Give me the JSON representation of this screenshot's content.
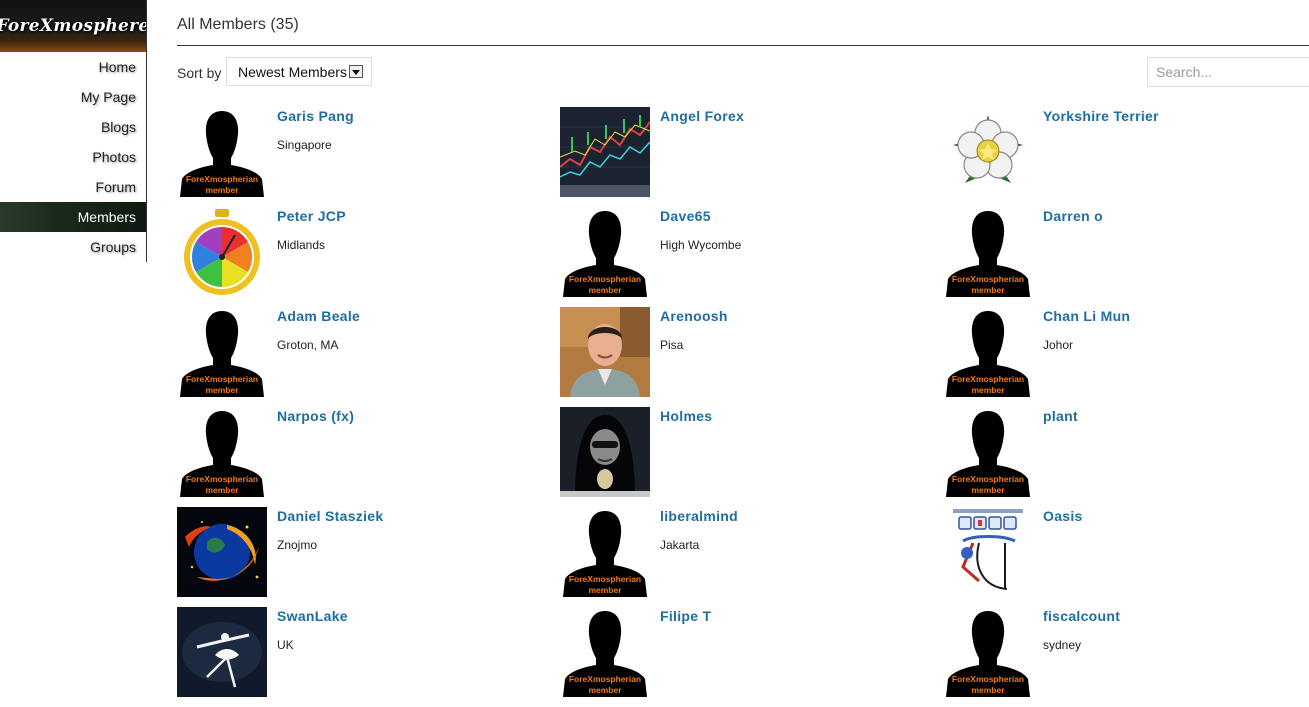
{
  "site": {
    "logo_text": "ForeXmosphere"
  },
  "nav": [
    {
      "label": "Home",
      "active": false
    },
    {
      "label": "My Page",
      "active": false
    },
    {
      "label": "Blogs",
      "active": false
    },
    {
      "label": "Photos",
      "active": false
    },
    {
      "label": "Forum",
      "active": false
    },
    {
      "label": "Members",
      "active": true
    },
    {
      "label": "Groups",
      "active": false
    }
  ],
  "page": {
    "title": "All Members (35)"
  },
  "sort": {
    "label": "Sort by",
    "selected": "Newest Members"
  },
  "search": {
    "placeholder": "Search..."
  },
  "silhouette_text": [
    "ForeXmospherian",
    "member"
  ],
  "members": [
    {
      "name": "Garis Pang",
      "location": "Singapore",
      "avatar": "silhouette"
    },
    {
      "name": "Angel Forex",
      "location": "",
      "avatar": "forex-chart"
    },
    {
      "name": "Yorkshire Terrier",
      "location": "",
      "avatar": "white-rose"
    },
    {
      "name": "Peter JCP",
      "location": "Midlands",
      "avatar": "stopwatch"
    },
    {
      "name": "Dave65",
      "location": "High Wycombe",
      "avatar": "silhouette"
    },
    {
      "name": "Darren o",
      "location": "",
      "avatar": "silhouette"
    },
    {
      "name": "Adam Beale",
      "location": "Groton, MA",
      "avatar": "silhouette"
    },
    {
      "name": "Arenoosh",
      "location": "Pisa",
      "avatar": "photo-man"
    },
    {
      "name": "Chan Li Mun",
      "location": "Johor",
      "avatar": "silhouette"
    },
    {
      "name": "Narpos (fx)",
      "location": "",
      "avatar": "silhouette"
    },
    {
      "name": "Holmes",
      "location": "",
      "avatar": "hooded-figure"
    },
    {
      "name": "plant",
      "location": "",
      "avatar": "silhouette"
    },
    {
      "name": "Daniel Stasziek",
      "location": "Znojmo",
      "avatar": "fire-globe"
    },
    {
      "name": "liberalmind",
      "location": "Jakarta",
      "avatar": "silhouette"
    },
    {
      "name": "Oasis",
      "location": "",
      "avatar": "oasis-logo"
    },
    {
      "name": "SwanLake",
      "location": "UK",
      "avatar": "ballerina"
    },
    {
      "name": "Filipe T",
      "location": "",
      "avatar": "silhouette"
    },
    {
      "name": "fiscalcount",
      "location": "sydney",
      "avatar": "silhouette"
    }
  ],
  "colors": {
    "link": "#1e6ea0",
    "badge_text": "#f07a18",
    "active_nav": "#1a2a1a"
  }
}
